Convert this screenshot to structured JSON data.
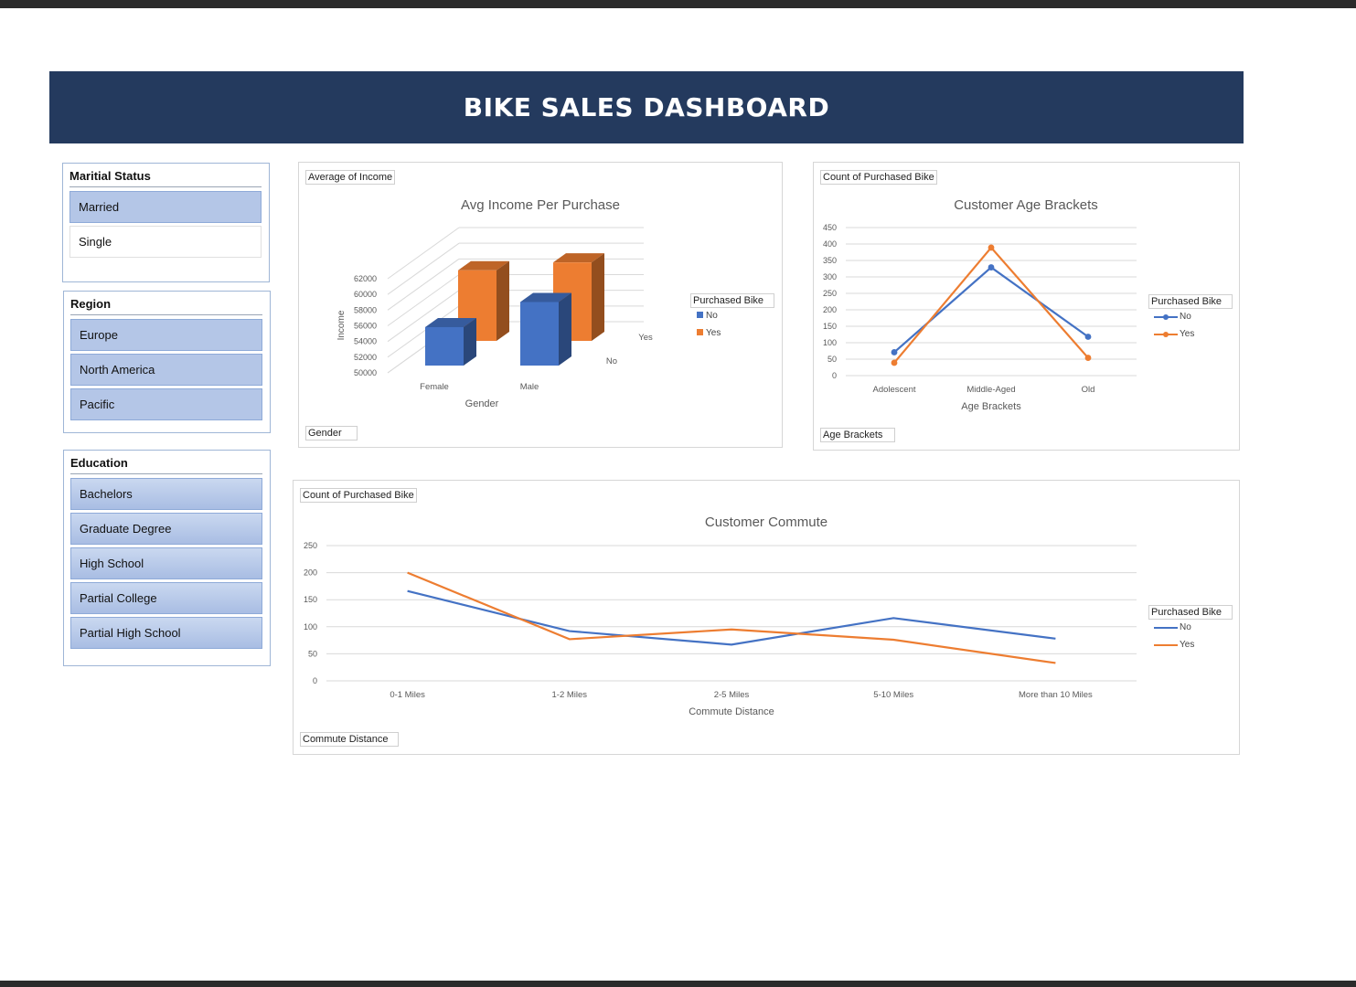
{
  "dashboard_title": "BIKE SALES DASHBOARD",
  "slicers": {
    "marital": {
      "title": "Maritial Status",
      "items": [
        "Married",
        "Single"
      ]
    },
    "region": {
      "title": "Region",
      "items": [
        "Europe",
        "North America",
        "Pacific"
      ]
    },
    "education": {
      "title": "Education",
      "items": [
        "Bachelors",
        "Graduate Degree",
        "High School",
        "Partial College",
        "Partial High School"
      ]
    }
  },
  "income_chart": {
    "field_value": "Average of Income",
    "field_axis": "Gender",
    "legend_title": "Purchased Bike",
    "legend_no": "No",
    "legend_yes": "Yes",
    "depth_yes": "Yes",
    "depth_no": "No"
  },
  "age_chart": {
    "field_value": "Count of Purchased Bike",
    "field_axis": "Age Brackets",
    "legend_title": "Purchased Bike",
    "legend_no": "No",
    "legend_yes": "Yes"
  },
  "commute_chart": {
    "field_value": "Count of Purchased Bike",
    "field_axis": "Commute Distance",
    "legend_title": "Purchased Bike",
    "legend_no": "No",
    "legend_yes": "Yes"
  },
  "colors": {
    "banner": "#243a5e",
    "no_series": "#4472c4",
    "yes_series": "#ed7d31",
    "slicer_selected": "#b4c6e7"
  },
  "chart_data": [
    {
      "type": "bar",
      "title": "Avg Income Per Purchase",
      "xlabel": "Gender",
      "ylabel": "Income",
      "categories": [
        "Female",
        "Male"
      ],
      "series": [
        {
          "name": "No",
          "values": [
            54900,
            58100
          ]
        },
        {
          "name": "Yes",
          "values": [
            59000,
            60000
          ]
        }
      ],
      "ylim": [
        50000,
        62000
      ],
      "yticks": [
        50000,
        52000,
        54000,
        56000,
        58000,
        60000,
        62000
      ],
      "legend": "right"
    },
    {
      "type": "line",
      "title": "Customer Age Brackets",
      "xlabel": "Age Brackets",
      "ylabel": "",
      "categories": [
        "Adolescent",
        "Middle-Aged",
        "Old"
      ],
      "series": [
        {
          "name": "No",
          "values": [
            71,
            329,
            118
          ]
        },
        {
          "name": "Yes",
          "values": [
            39,
            389,
            54
          ]
        }
      ],
      "ylim": [
        0,
        450
      ],
      "yticks": [
        0,
        50,
        100,
        150,
        200,
        250,
        300,
        350,
        400,
        450
      ],
      "markers": true,
      "legend": "right"
    },
    {
      "type": "line",
      "title": "Customer Commute",
      "xlabel": "Commute Distance",
      "ylabel": "",
      "categories": [
        "0-1 Miles",
        "1-2 Miles",
        "2-5 Miles",
        "5-10 Miles",
        "More than 10 Miles"
      ],
      "series": [
        {
          "name": "No",
          "values": [
            166,
            92,
            67,
            116,
            78
          ]
        },
        {
          "name": "Yes",
          "values": [
            200,
            77,
            95,
            76,
            33
          ]
        }
      ],
      "ylim": [
        0,
        250
      ],
      "yticks": [
        0,
        50,
        100,
        150,
        200,
        250
      ],
      "legend": "right"
    }
  ]
}
